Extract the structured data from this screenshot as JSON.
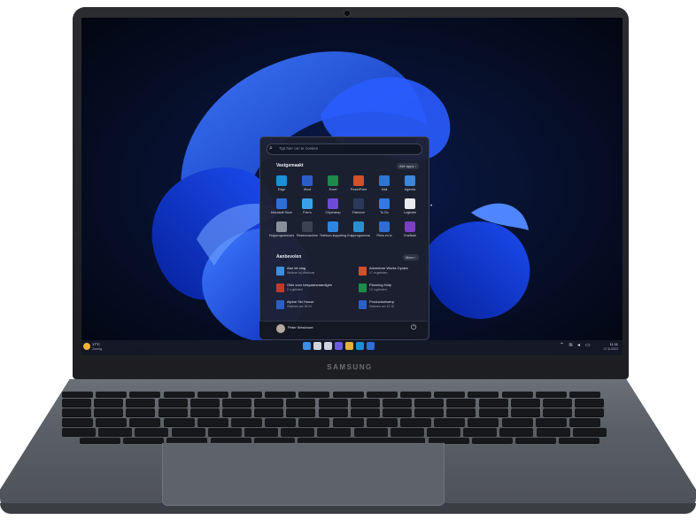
{
  "brand": {
    "label": "SAMSUNG"
  },
  "start_menu": {
    "search_placeholder": "Typ hier om te zoeken",
    "pinned_header": "Vastgemaakt",
    "all_apps_label": "Alle apps ›",
    "pinned": [
      {
        "label": "Edge",
        "icon": "edge-icon",
        "color": "#1b8fd8"
      },
      {
        "label": "Word",
        "icon": "word-icon",
        "color": "#2b5fc7"
      },
      {
        "label": "Excel",
        "icon": "excel-icon",
        "color": "#1d8a4a"
      },
      {
        "label": "PowerPoint",
        "icon": "powerpoint-icon",
        "color": "#d2502a"
      },
      {
        "label": "Mail",
        "icon": "mail-icon",
        "color": "#2a78d4"
      },
      {
        "label": "Agenda",
        "icon": "calendar-icon",
        "color": "#3f86d8"
      },
      {
        "label": "Microsoft Store",
        "icon": "store-icon",
        "color": "#2d6fd6"
      },
      {
        "label": "Foto's",
        "icon": "photos-icon",
        "color": "#3aa2e6"
      },
      {
        "label": "Clipchamp",
        "icon": "clipchamp-icon",
        "color": "#6d4bd8"
      },
      {
        "label": "Patience",
        "icon": "solitaire-icon",
        "color": "#2b3a5a"
      },
      {
        "label": "To Do",
        "icon": "todo-icon",
        "color": "#2f7ae5"
      },
      {
        "label": "Logboek",
        "icon": "journal-icon",
        "color": "#e8eaf0"
      },
      {
        "label": "Hulpprogramma's",
        "icon": "tools-icon",
        "color": "#8a8f9c"
      },
      {
        "label": "Rekenmachine",
        "icon": "calculator-icon",
        "color": "#3d4252"
      },
      {
        "label": "Telefoon-koppeling",
        "icon": "phone-link-icon",
        "color": "#2f86e0"
      },
      {
        "label": "Knipprogramma",
        "icon": "snipping-icon",
        "color": "#2a8fd0"
      },
      {
        "label": "Films en tv",
        "icon": "movies-icon",
        "color": "#2b6fd6"
      },
      {
        "label": "OneNote",
        "icon": "onenote-icon",
        "color": "#7b3fbf"
      }
    ],
    "recommended_header": "Aanbevolen",
    "more_label": "Meer ›",
    "recommended": [
      {
        "title": "Aan de slag",
        "sub": "Welkom bij Windows",
        "icon": "get-started-icon",
        "color": "#3b8fe0"
      },
      {
        "title": "Adventure Works Cycles",
        "sub": "17 m geleden",
        "icon": "pptx-icon",
        "color": "#d2502a"
      },
      {
        "title": "Gids voor bespaarwaardigen",
        "sub": "2 u geleden",
        "icon": "pdf-icon",
        "color": "#c0392b"
      },
      {
        "title": "Planning Hoty",
        "sub": "12 u geleden",
        "icon": "xlsx-icon",
        "color": "#1d8a4a"
      },
      {
        "title": "Alpine Ski House",
        "sub": "Gisteren om 18:24",
        "icon": "docx-icon",
        "color": "#2b5fc7"
      },
      {
        "title": "Productontwerp",
        "sub": "Gisteren om 12:15",
        "icon": "docx-icon",
        "color": "#2b5fc7"
      }
    ],
    "user_name": "Peter Westvoort"
  },
  "taskbar": {
    "weather_temp": "17°C",
    "weather_desc": "Zonnig",
    "time": "11:11",
    "date": "27-6-2023",
    "apps": [
      {
        "icon": "windows-start-icon",
        "color": "#3a8ee8"
      },
      {
        "icon": "search-icon",
        "color": "#cfd3dc"
      },
      {
        "icon": "task-view-icon",
        "color": "#cfd3dc"
      },
      {
        "icon": "chat-icon",
        "color": "#6b5be0"
      },
      {
        "icon": "file-explorer-icon",
        "color": "#e2b23a"
      },
      {
        "icon": "edge-icon",
        "color": "#1b8fd8"
      },
      {
        "icon": "store-icon",
        "color": "#2d6fd6"
      }
    ]
  }
}
